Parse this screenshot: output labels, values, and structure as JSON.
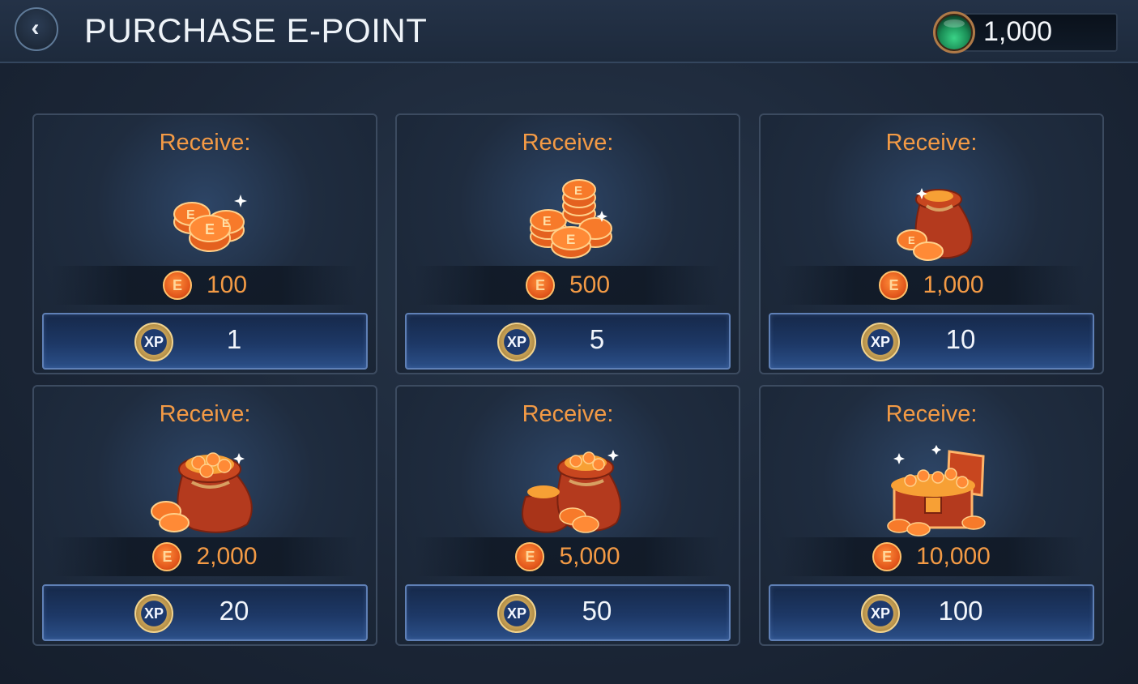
{
  "header": {
    "title": "PURCHASE E-POINT",
    "back_icon": "chevron-left-icon",
    "balance": "1,000",
    "balance_icon": "green-orb-icon"
  },
  "packages": [
    {
      "receive_label": "Receive:",
      "amount": "100",
      "price": "1",
      "art": "coins-small"
    },
    {
      "receive_label": "Receive:",
      "amount": "500",
      "price": "5",
      "art": "coins-stack"
    },
    {
      "receive_label": "Receive:",
      "amount": "1,000",
      "price": "10",
      "art": "bag-small"
    },
    {
      "receive_label": "Receive:",
      "amount": "2,000",
      "price": "20",
      "art": "bag-large"
    },
    {
      "receive_label": "Receive:",
      "amount": "5,000",
      "price": "50",
      "art": "bags-double"
    },
    {
      "receive_label": "Receive:",
      "amount": "10,000",
      "price": "100",
      "art": "treasure-chest"
    }
  ],
  "currency_icon_text": "E",
  "price_icon_text": "XP",
  "colors": {
    "accent_orange": "#f39a45",
    "button_blue": "#1d3866",
    "background": "#1c2738"
  }
}
